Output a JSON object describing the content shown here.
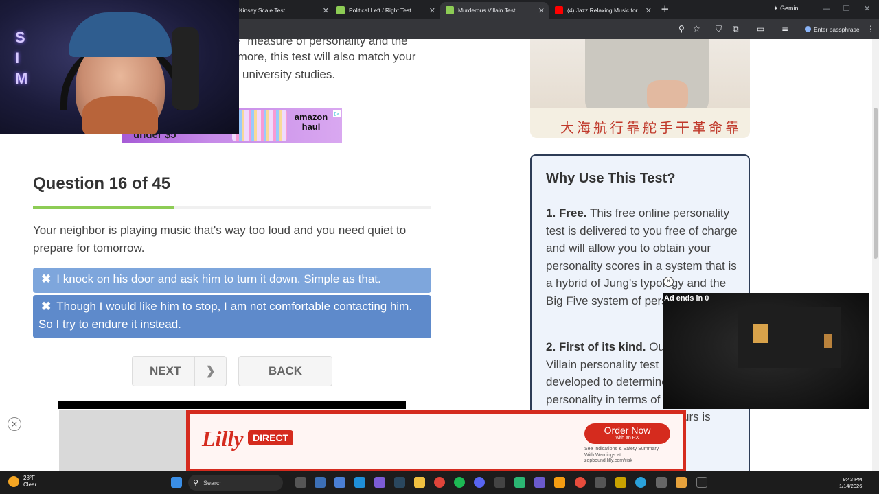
{
  "browser": {
    "tabs": [
      {
        "title": "Kinsey Scale Test",
        "active": false
      },
      {
        "title": "Political Left / Right Test",
        "active": false
      },
      {
        "title": "Murderous Villain Test",
        "active": true
      },
      {
        "title": "(4) Jazz Relaxing Music for",
        "active": false
      }
    ],
    "gemini_label": "Gemini",
    "passphrase_label": "Enter passphrase",
    "new_tab": "+"
  },
  "intro": {
    "line1": "e \"measure of personality and the",
    "line2": "rmore, this test will also match your",
    "line3": "university studies."
  },
  "amazon_ad": {
    "brand": "amazon",
    "tag": "haul",
    "under": "under $5"
  },
  "question": {
    "title": "Question 16 of 45",
    "progress_fraction": 0.356,
    "text": "Your neighbor is playing music that's way too loud and you need quiet to prepare for tomorrow.",
    "answers": [
      {
        "icon": "✖",
        "text": "I knock on his door and ask him to turn it down. Simple as that."
      },
      {
        "icon": "✖",
        "text": "Though I would like him to stop, I am not comfortable contacting him. So I try to endure it instead."
      }
    ],
    "next_label": "NEXT",
    "back_label": "BACK"
  },
  "poster": {
    "caption": "大海航行靠舵手干革命靠"
  },
  "why": {
    "title": "Why Use This Test?",
    "p1_lead": "1. Free.",
    "p1_text": " This free online personality test is delivered to you free of charge and will allow you to obtain your personality scores in a system that is a hybrid of Jung's typology and the Big Five system of personality.",
    "p2_lead": "2. First of its kind.",
    "p2_text": " Our Murderous Villain personality test has been developed to determine your personality in terms of villain archetypes. Specifically, Ours is"
  },
  "video_ad": {
    "label": "Ad ends in 0",
    "close": "×"
  },
  "bottom_ad": {
    "close": "×",
    "logo": "Lilly",
    "direct": "DIRECT",
    "cta": "Order Now",
    "cta_sub": "with an RX",
    "fine1": "See Indications & Safety Summary",
    "fine2": "With Warnings at",
    "fine3": "zepbound.lilly.com/risk"
  },
  "taskbar": {
    "temp": "28°F",
    "condition": "Clear",
    "search_placeholder": "Search",
    "time": "9:43 PM",
    "date": "1/14/2026"
  },
  "colors": {
    "answer1_bg": "#7ea6dc",
    "answer2_bg": "#5e8acb",
    "progress": "#8dcc55",
    "lilly_red": "#d52b1e"
  }
}
